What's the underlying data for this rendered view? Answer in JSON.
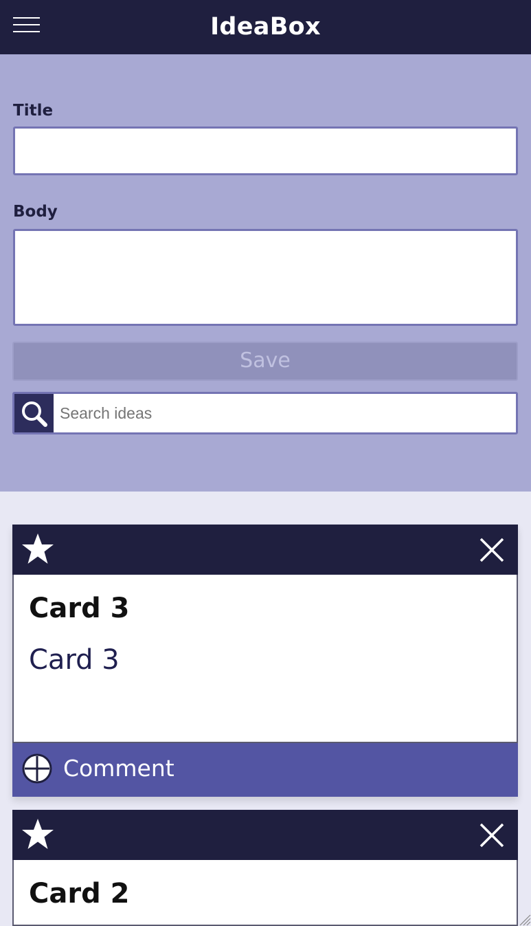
{
  "app": {
    "title": "IdeaBox"
  },
  "form": {
    "title_label": "Title",
    "body_label": "Body",
    "title_value": "",
    "body_value": "",
    "save_label": "Save",
    "search_placeholder": "Search ideas"
  },
  "cards": [
    {
      "title": "Card 3",
      "body": "Card 3",
      "comment_label": "Comment"
    },
    {
      "title": "Card 2"
    }
  ],
  "icons": {
    "menu": "hamburger-icon",
    "search": "search-icon",
    "favorite": "star-icon",
    "delete": "close-icon",
    "add_comment": "plus-circle-icon"
  },
  "colors": {
    "header_bg": "#1f1f3f",
    "form_bg": "#a8a9d3",
    "field_border": "#7474b3",
    "save_disabled_bg": "#9091bb",
    "comment_bar_bg": "#5355a3",
    "page_bg": "#e8e8f4"
  }
}
